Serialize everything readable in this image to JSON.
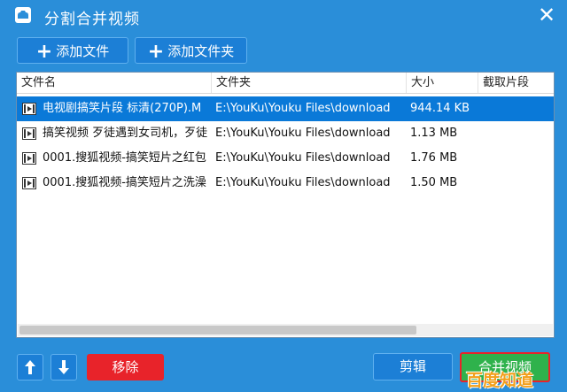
{
  "window": {
    "title": "分割合并视频",
    "close_glyph": "✕"
  },
  "toolbar": {
    "add_file_label": "添加文件",
    "add_folder_label": "添加文件夹"
  },
  "table": {
    "columns": [
      "文件名",
      "文件夹",
      "大小",
      "截取片段"
    ],
    "rows": [
      {
        "name": "电视剧搞笑片段 标清(270P).M",
        "folder": "E:\\YouKu\\Youku Files\\download",
        "size": "944.14 KB",
        "clip": ""
      },
      {
        "name": "搞笑视频 歹徒遇到女司机，歹徒",
        "folder": "E:\\YouKu\\Youku Files\\download",
        "size": "1.13 MB",
        "clip": ""
      },
      {
        "name": "0001.搜狐视频-搞笑短片之红包",
        "folder": "E:\\YouKu\\Youku Files\\download",
        "size": "1.76 MB",
        "clip": ""
      },
      {
        "name": "0001.搜狐视频-搞笑短片之洗澡",
        "folder": "E:\\YouKu\\Youku Files\\download",
        "size": "1.50 MB",
        "clip": ""
      }
    ]
  },
  "footer": {
    "remove_label": "移除",
    "cut_label": "剪辑",
    "merge_label": "合并视频"
  },
  "watermark": "百度知道",
  "colors": {
    "primary": "#1c7fd6",
    "danger": "#e8232a",
    "success": "#2fb24c",
    "selected_row": "#0a79d8"
  }
}
